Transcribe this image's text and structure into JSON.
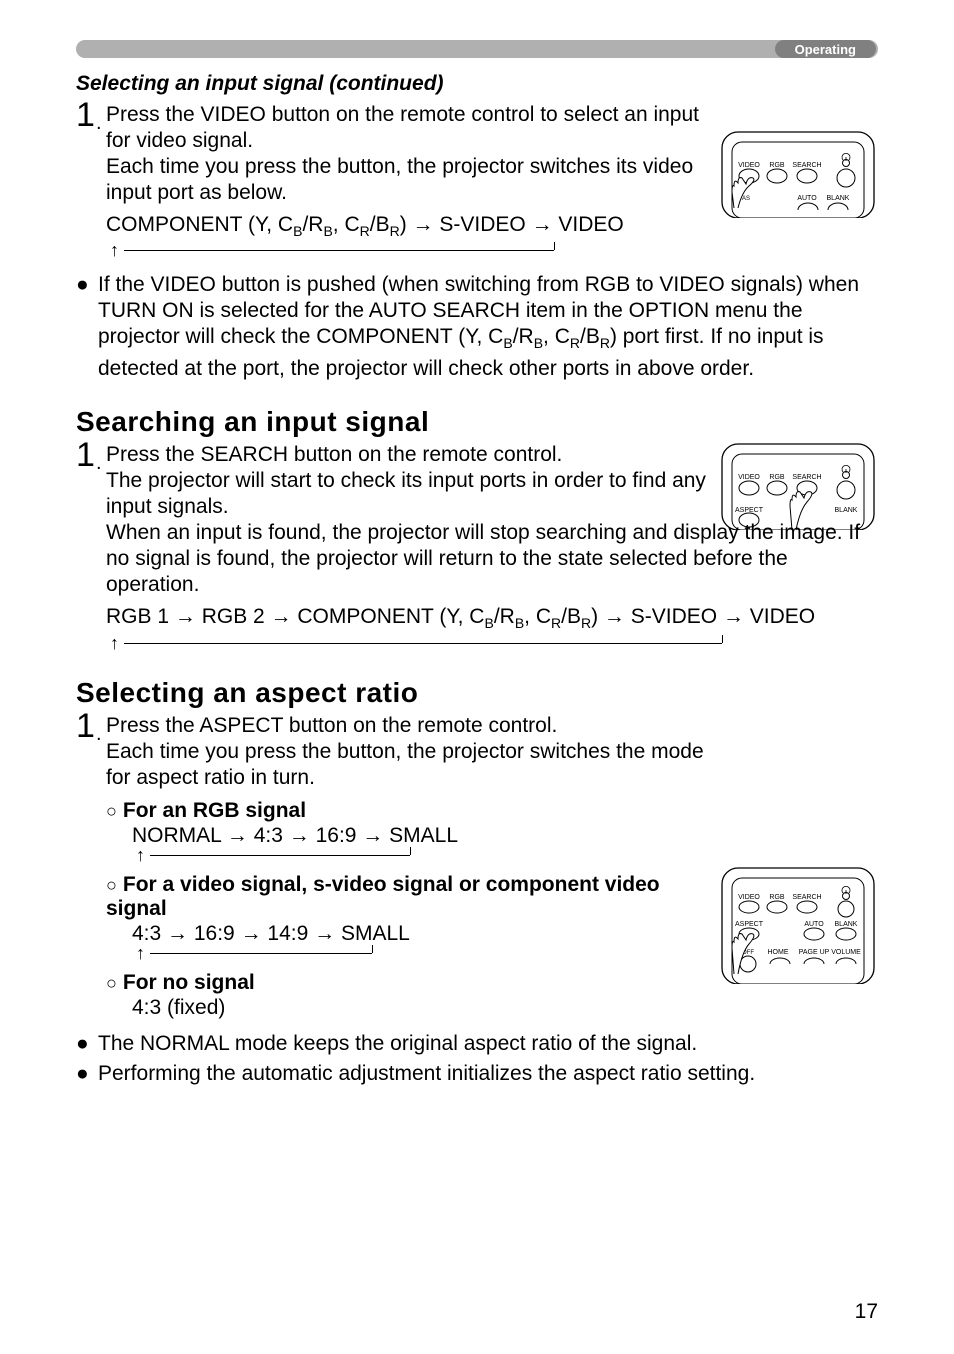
{
  "header": {
    "tag": "Operating"
  },
  "page_number": "17",
  "section_continued": {
    "title": "Selecting an input signal (continued)"
  },
  "video": {
    "step_num": "1",
    "step_dot": ".",
    "line1": "Press the VIDEO button on the remote control to select an input for video signal.",
    "line2": "Each time you press the button, the projector switches its video input port as below.",
    "flow_prefix": "COMPONENT (Y, C",
    "flow_b": "B",
    "flow_mid1": "/R",
    "flow_mid2": ", C",
    "flow_r": "R",
    "flow_mid3": "/B",
    "flow_suffix": ")  →  S-VIDEO  →  VIDEO",
    "bullet": "If the VIDEO button is pushed (when switching from RGB to VIDEO signals) when TURN ON is selected for the AUTO SEARCH item in the OPTION menu the projector will check the COMPONENT (Y, C",
    "bullet_mid": ") port first. If no input is detected at the port, the projector will check other ports in above order."
  },
  "searching": {
    "title": "Searching an input signal",
    "step_num": "1",
    "step_dot": ".",
    "line1": "Press the SEARCH button on the remote control.",
    "line2": "The projector will start to check its input ports in order to find any input signals.",
    "line3": "When an input is found, the projector will stop searching and display the image. If no signal is found, the projector will return to the state selected before the operation.",
    "flow_prefix": "RGB 1 → RGB 2 → COMPONENT (Y, C",
    "flow_suffix": ") → S-VIDEO → VIDEO"
  },
  "aspect": {
    "title": "Selecting an aspect ratio",
    "step_num": "1",
    "step_dot": ".",
    "line1": "Press the ASPECT button on the remote control.",
    "line2": "Each time you press the button, the projector switches the mode for aspect ratio in turn.",
    "rgb_label": "For an RGB signal",
    "rgb_flow": "NORMAL → 4:3 → 16:9 → SMALL",
    "video_label": "For a video signal, s-video signal or component video signal",
    "video_flow": "4:3 → 16:9 → 14:9 → SMALL",
    "none_label": "For no signal",
    "none_flow": "4:3 (fixed)",
    "bullet1": "The NORMAL mode keeps the original aspect ratio of the signal.",
    "bullet2": "Performing the automatic adjustment initializes the aspect ratio setting."
  },
  "remote_labels": {
    "video": "VIDEO",
    "rgb": "RGB",
    "search": "SEARCH",
    "aspect": "ASPECT",
    "auto": "AUTO",
    "blank": "BLANK",
    "off": "OFF",
    "home": "HOME",
    "pageup": "PAGE UP",
    "volume": "VOLUME"
  }
}
